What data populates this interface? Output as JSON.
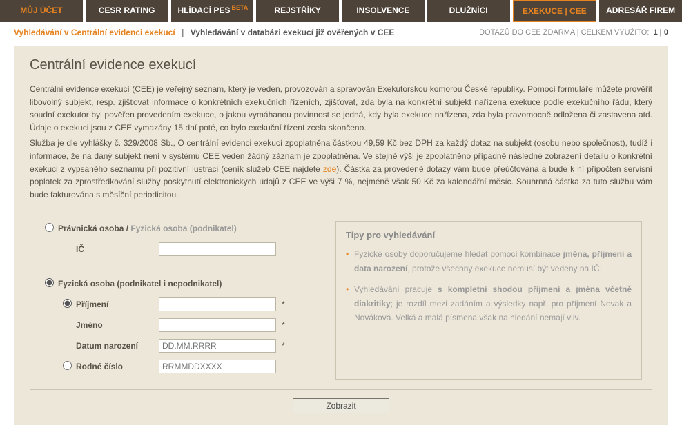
{
  "nav": {
    "tabs": [
      {
        "label": "MŮJ ÚČET"
      },
      {
        "label": "CESR RATING"
      },
      {
        "label": "HLÍDACÍ PES",
        "beta": "BETA"
      },
      {
        "label": "REJSTŘÍKY"
      },
      {
        "label": "INSOLVENCE"
      },
      {
        "label": "DLUŽNÍCI"
      },
      {
        "label": "EXEKUCE | CEE"
      },
      {
        "label": "ADRESÁŘ FIREM"
      }
    ]
  },
  "subbar": {
    "link1": "Vyhledávání v Centrální evidenci exekucí",
    "sep": "|",
    "link2": "Vyhledávání v databázi exekucí již ověřených v CEE",
    "right_prefix": "DOTAZŮ DO CEE ZDARMA | CELKEM VYUŽITO:",
    "right_val": "1 | 0"
  },
  "panel": {
    "title": "Centrální evidence exekucí",
    "para1": "Centrální evidence exekucí (CEE) je veřejný seznam, který je veden, provozován a spravován Exekutorskou komorou České republiky. Pomocí formuláře můžete prověřit libovolný subjekt, resp. zjišťovat informace o konkrétních exekučních řízeních, zjišťovat, zda byla na konkrétní subjekt nařízena exekuce podle exekučního řádu, který soudní exekutor byl pověřen provedením exekuce, o jakou vymáhanou povinnost se jedná, kdy byla exekuce nařízena, zda byla pravomocně odložena či zastavena atd. Údaje o exekuci jsou z CEE vymazány 15 dní poté, co bylo exekuční řízení zcela skončeno.",
    "para2a": "Služba je dle vyhlášky č. 329/2008 Sb., O centrální evidenci exekucí zpoplatněna částkou 49,59 Kč bez DPH za každý dotaz na subjekt (osobu nebo společnost), tudíž i informace, že na daný subjekt není v systému CEE veden žádný záznam je zpoplatněna. Ve stejné výši je zpoplatněno případné následné zobrazení detailu o konkrétní exekuci z vypsaného seznamu při pozitivní lustraci (ceník služeb CEE najdete ",
    "para2_link": "zde",
    "para2b": "). Částka za provedené dotazy vám bude přeúčtována a bude k ní připočten servisní poplatek za zprostředkování služby  poskytnutí elektronických údajů z CEE  ve výši 7 %, nejméně však 50 Kč za kalendářní měsíc. Souhrnná částka za tuto službu vám bude fakturována s měsíční periodicitou."
  },
  "form": {
    "opt1_title_a": "Právnická osoba / ",
    "opt1_title_b": "Fyzická osoba (podnikatel)",
    "ic_label": "IČ",
    "opt2_title": "Fyzická osoba (podnikatel i nepodnikatel)",
    "surname_label": "Příjmení",
    "name_label": "Jméno",
    "dob_label": "Datum narození",
    "dob_placeholder": "DD.MM.RRRR",
    "rc_label": "Rodné číslo",
    "rc_placeholder": "RRMMDDXXXX",
    "submit": "Zobrazit"
  },
  "tips": {
    "title": "Tipy pro vyhledávání",
    "t1a": "Fyzické osoby doporučujeme hledat pomocí kombinace ",
    "t1b": "jména, příjmení a data narození",
    "t1c": ", protože všechny exekuce nemusí být vedeny na IČ.",
    "t2a": "Vyhledávání pracuje ",
    "t2b": "s kompletní shodou příjmení a jména včetně diakritiky",
    "t2c": "; je rozdíl mezi zadáním a výsledky např. pro příjmení Novak a Nováková. Velká a malá písmena však na hledání nemají vliv."
  }
}
